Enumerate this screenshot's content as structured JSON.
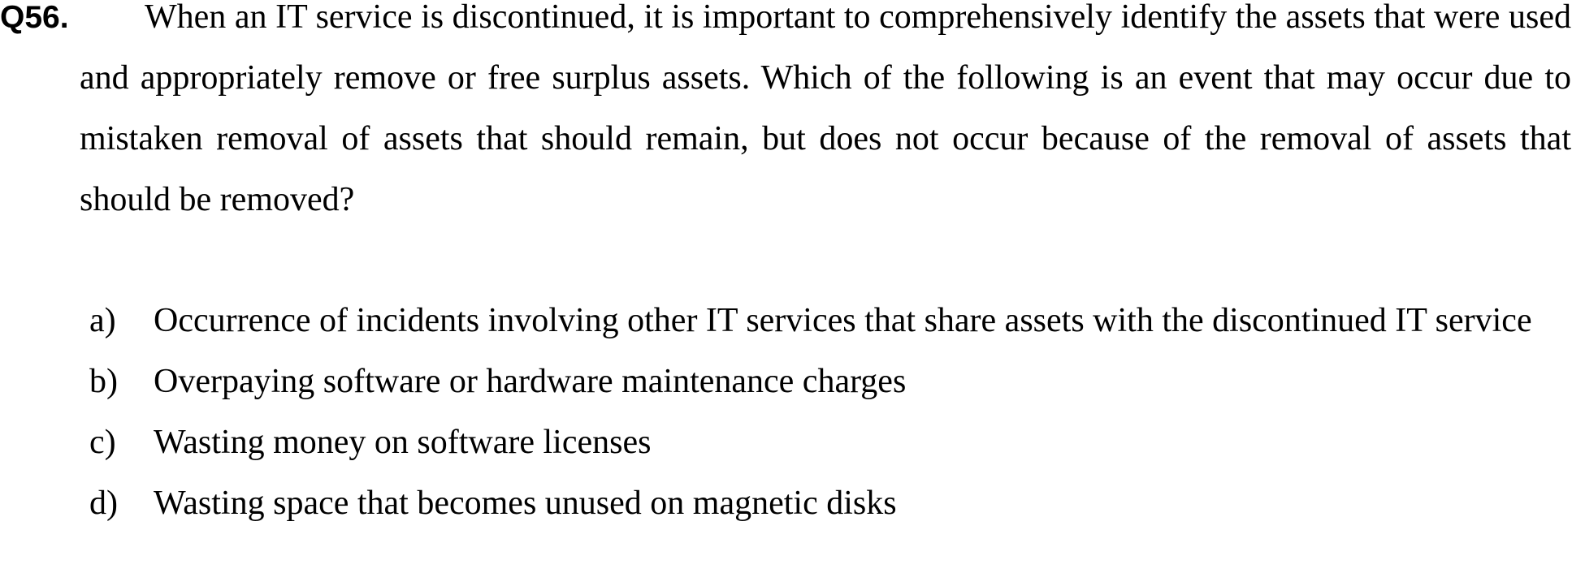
{
  "question": {
    "number": "Q56.",
    "text": "When an IT service is discontinued, it is important to comprehensively identify the assets that were used and appropriately remove or free surplus assets. Which of the following is an event that may occur due to mistaken removal of assets that should remain, but does not occur because of the removal of assets that should be removed?"
  },
  "options": [
    {
      "letter": "a)",
      "text": "Occurrence of incidents involving other IT services that share assets with the discontinued IT service"
    },
    {
      "letter": "b)",
      "text": "Overpaying software or hardware maintenance charges"
    },
    {
      "letter": "c)",
      "text": "Wasting money on software licenses"
    },
    {
      "letter": "d)",
      "text": "Wasting space that becomes unused on magnetic disks"
    }
  ]
}
